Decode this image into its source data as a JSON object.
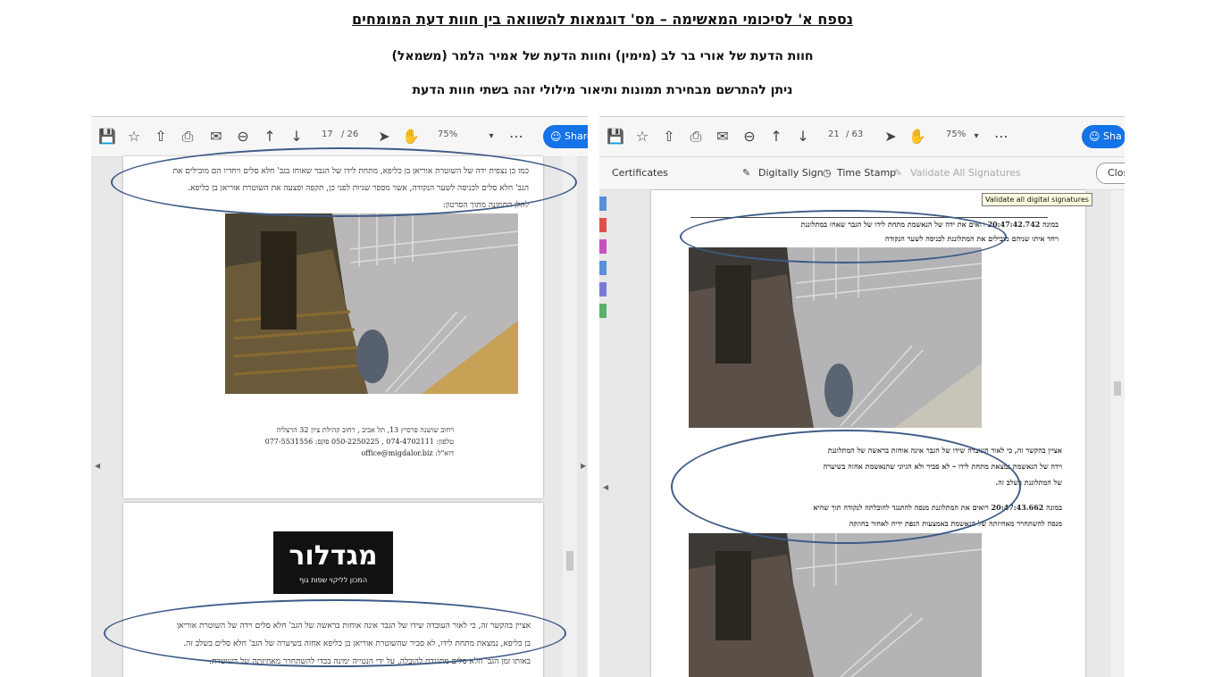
{
  "header": {
    "title": "נספח א' לסיכומי המאשימה – מס' דוגמאות להשוואה בין חוות דעת המומחים",
    "subtitle": "חוות הדעת של אורי בר לב (מימין) וחוות הדעת של אמיר הלמר (משמאל)",
    "note": "ניתן להתרשם מבחירת תמונות ותיאור מילולי זהה בשתי חוות הדעת"
  },
  "left_viewer": {
    "page_current": "17",
    "page_total": "/ 26",
    "zoom": "75%",
    "share_label": "Share",
    "text_top": [
      "כמו כן נצפית ידה של השוטרת אוריאן בן כליפא, מתחת לידו של הגבר שאוחז בגב' חלא סלים ויחדיו הם מובילים את",
      "הגב' חלא סלים לכניסה לשער הנקודה, אשר מספר שניות לפני כן, תקפה ופצעה את השוטרת אוריאן בן כליפא.",
      "להלן התמונה מתוך הסרטון:"
    ],
    "footer_lines": [
      "רחוב שושנה פרסיץ 13, תל אביב , רחוב קהילת ציון 32 הרצליה",
      "טלפון: 074-4702111 , 050-2250225 פקס: 077-5531556",
      "דוא\"ל: office@migdalor.biz"
    ],
    "logo_main": "מגדלור",
    "logo_sub": "המכון לליקוי שפות גוף",
    "text_bottom": [
      "אציין בהקשר זה, כי לאור העובדה שידו של הגבר אינה אוחזת בראשה של הגב' חלא סלים וידה של השוטרת אוריאן",
      "בן כליפא, נמצאת מתחת לידו, לא סביר שהשוטרת אוריאן בן כליפא אחזה בשיערה של הגב' חלא סלים בשלב זה.",
      "באותו זמן הגב' חלא סלים מתנגדת להובלה, על ידי הנטייה ימינה בכדי להשתחרר מאחיזתה של השוטרת."
    ]
  },
  "right_viewer": {
    "page_current": "21",
    "page_total": "/ 63",
    "zoom": "75%",
    "share_label": "Sha",
    "cert_label": "Certificates",
    "digitally_sign": "Digitally Sign",
    "time_stamp": "Time Stamp",
    "validate_all": "Validate All Signatures",
    "close_label": "Clos",
    "tooltip": "Validate all digital signatures",
    "text_top": [
      "במונה 20:47:42.742 רואים את ידה של הנאשמת מתחת לידו של הגבר שאחז במתלוננת",
      "ויחד איתו שניהם מובילים את המתלוננת לכניסה לשער הנקודה"
    ],
    "text_middle": [
      "אציין בהקשר זה, כי לאור העובדה שידו של הגבר אינה אוחזת בראשה של המתלוננת",
      "וידה של הנאשמת נמצאת מתחת לידו – לא סביר ולא הגיוני שהנאשמת אחזה בשיערה",
      "של המתלוננת בשלב זה."
    ],
    "text_middle2": [
      "במונה 20:47:43.662 רואים את המתלוננת מנסה להתנגד להובלתה לנקודה תוך שהיא",
      "מנסה להשתחרר מאחיזתה של הנאשמת באמצעות הנפת ידיה לאחור בחוזקה"
    ]
  }
}
